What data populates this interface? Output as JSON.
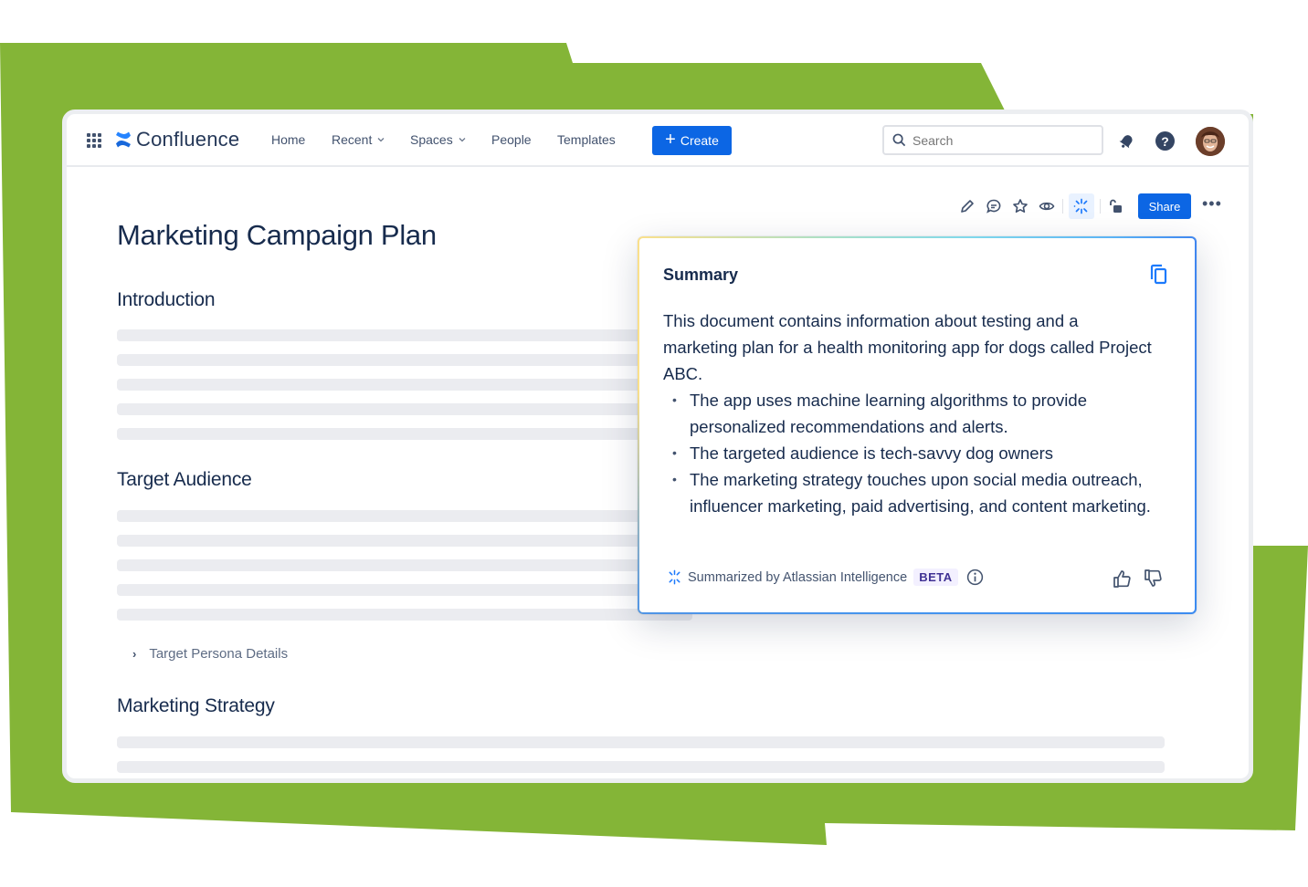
{
  "colors": {
    "background_green": "#84b537",
    "primary_blue": "#0c66e4",
    "text_dark": "#172b4d",
    "skeleton": "#ebecf0"
  },
  "nav": {
    "app_name": "Confluence",
    "items": [
      {
        "label": "Home",
        "has_dropdown": false
      },
      {
        "label": "Recent",
        "has_dropdown": true
      },
      {
        "label": "Spaces",
        "has_dropdown": true
      },
      {
        "label": "People",
        "has_dropdown": false
      },
      {
        "label": "Templates",
        "has_dropdown": false
      }
    ],
    "create_label": "Create",
    "search_placeholder": "Search",
    "icons": [
      "apps-grid-icon",
      "confluence-logo-icon",
      "search-icon",
      "notifications-icon",
      "help-icon",
      "avatar"
    ]
  },
  "page_toolbar": {
    "icons": [
      "edit-icon",
      "comment-icon",
      "star-icon",
      "watch-icon",
      "atlassian-intelligence-icon",
      "restrictions-lock-icon"
    ],
    "share_label": "Share",
    "more_label": "•••"
  },
  "page": {
    "title": "Marketing Campaign Plan",
    "sections": [
      {
        "heading": "Introduction",
        "skeleton_lines": 5
      },
      {
        "heading": "Target Audience",
        "skeleton_lines": 5
      },
      {
        "heading": "Marketing Strategy",
        "skeleton_lines": 2
      }
    ],
    "expand_label": "Target Persona Details"
  },
  "summary": {
    "title": "Summary",
    "intro": "This document contains information about testing and a marketing plan for a health monitoring app for dogs called Project ABC.",
    "bullets": [
      "The app uses machine learning algorithms to provide personalized recommendations and alerts.",
      "The targeted audience is tech-savvy dog owners",
      "The marketing strategy touches upon social media outreach, influencer marketing, paid advertising, and content marketing."
    ],
    "footer_label": "Summarized by Atlassian Intelligence",
    "badge": "BETA"
  }
}
